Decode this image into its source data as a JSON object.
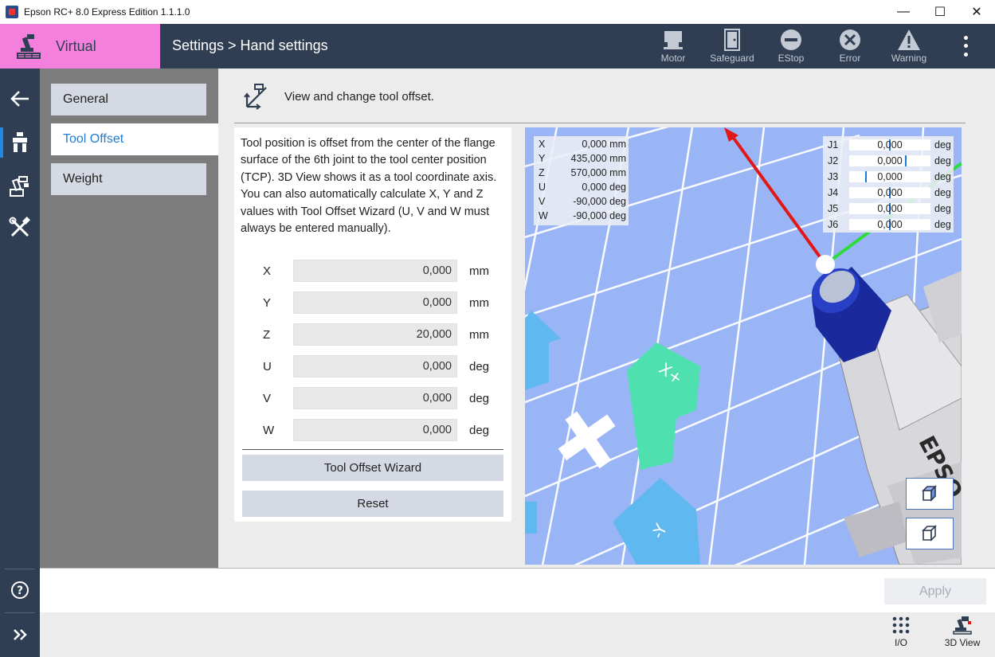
{
  "window": {
    "title": "Epson RC+ 8.0 Express Edition 1.1.1.0",
    "controls": {
      "minimize": "—",
      "maximize": "☐",
      "close": "✕"
    }
  },
  "header": {
    "mode_label": "Virtual",
    "breadcrumb": "Settings > Hand settings",
    "status": [
      {
        "label": "Motor",
        "icon": "motor-icon"
      },
      {
        "label": "Safeguard",
        "icon": "door-icon"
      },
      {
        "label": "EStop",
        "icon": "estop-icon"
      },
      {
        "label": "Error",
        "icon": "error-x-icon"
      },
      {
        "label": "Warning",
        "icon": "warning-triangle-icon"
      }
    ],
    "colors": {
      "mode_bg": "#f57fdc",
      "bar_bg": "#2f3e52"
    }
  },
  "sidebar": {
    "items": [
      {
        "name": "back",
        "icon": "back-arrow-icon"
      },
      {
        "name": "hand",
        "icon": "hand-icon",
        "active": true
      },
      {
        "name": "robot",
        "icon": "robot-icon"
      },
      {
        "name": "tools",
        "icon": "tools-icon"
      },
      {
        "name": "help",
        "icon": "help-icon"
      },
      {
        "name": "expand",
        "icon": "expand-icon"
      }
    ]
  },
  "submenu": {
    "items": [
      {
        "label": "General"
      },
      {
        "label": "Tool Offset",
        "active": true
      },
      {
        "label": "Weight"
      }
    ]
  },
  "content": {
    "header_text": "View and change tool offset.",
    "description": [
      "Tool position is offset from the center of the flange surface of the 6th joint to the tool center position (TCP). 3D View shows it as a tool coordinate axis.",
      "You can also automatically calculate X, Y and Z values with Tool Offset Wizard (U, V and W must always be entered manually)."
    ],
    "fields": [
      {
        "label": "X",
        "value": "0,000",
        "unit": "mm"
      },
      {
        "label": "Y",
        "value": "0,000",
        "unit": "mm"
      },
      {
        "label": "Z",
        "value": "20,000",
        "unit": "mm"
      },
      {
        "label": "U",
        "value": "0,000",
        "unit": "deg"
      },
      {
        "label": "V",
        "value": "0,000",
        "unit": "deg"
      },
      {
        "label": "W",
        "value": "0,000",
        "unit": "deg"
      }
    ],
    "wizard_button": "Tool Offset Wizard",
    "reset_button": "Reset"
  },
  "view3d": {
    "coords": [
      {
        "label": "X",
        "value": "0,000 mm"
      },
      {
        "label": "Y",
        "value": "435,000 mm"
      },
      {
        "label": "Z",
        "value": "570,000 mm"
      },
      {
        "label": "U",
        "value": "0,000 deg"
      },
      {
        "label": "V",
        "value": "-90,000 deg"
      },
      {
        "label": "W",
        "value": "-90,000 deg"
      }
    ],
    "joints": [
      {
        "label": "J1",
        "value": "0,000",
        "unit": "deg",
        "level": 0.5
      },
      {
        "label": "J2",
        "value": "0,000",
        "unit": "deg",
        "level": 0.7
      },
      {
        "label": "J3",
        "value": "0,000",
        "unit": "deg",
        "level": 0.2
      },
      {
        "label": "J4",
        "value": "0,000",
        "unit": "deg",
        "level": 0.5
      },
      {
        "label": "J5",
        "value": "0,000",
        "unit": "deg",
        "level": 0.5
      },
      {
        "label": "J6",
        "value": "0,000",
        "unit": "deg",
        "level": 0.5
      }
    ],
    "markers": {
      "x_plus": "X+",
      "y_minus": "-Y",
      "robot_brand": "EPSO"
    },
    "colors": {
      "floor": "#9ab5f6",
      "robot_flange": "#1a2a9c",
      "x_axis": "#e01818",
      "y_axis": "#2ddc3c"
    }
  },
  "footer": {
    "apply_button": "Apply",
    "buttons": [
      {
        "label": "I/O",
        "icon": "io-grid-icon"
      },
      {
        "label": "3D View",
        "icon": "robot-3d-icon"
      }
    ]
  }
}
